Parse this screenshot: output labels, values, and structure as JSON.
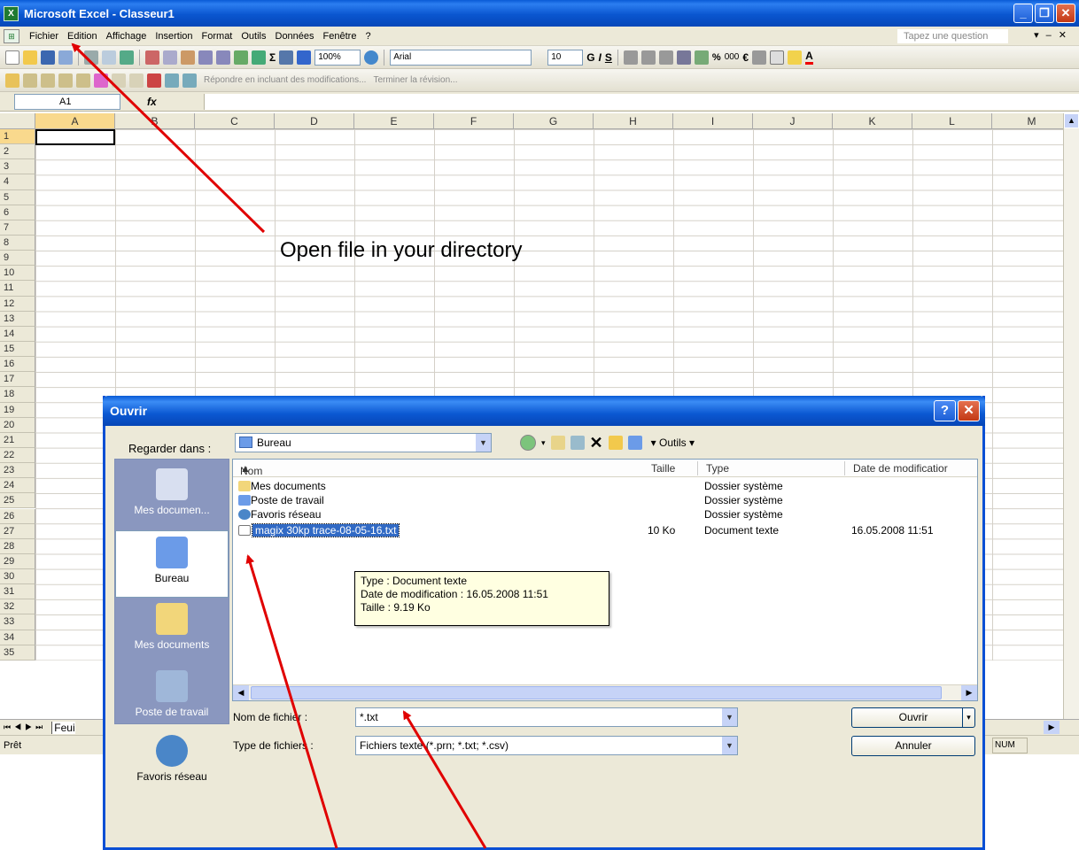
{
  "window": {
    "title": "Microsoft Excel - Classeur1",
    "app_icon": "excel-icon"
  },
  "menu": {
    "items": [
      "Fichier",
      "Edition",
      "Affichage",
      "Insertion",
      "Format",
      "Outils",
      "Données",
      "Fenêtre",
      "?"
    ],
    "help_placeholder": "Tapez une question"
  },
  "toolbar": {
    "zoom": "100%",
    "font": "Arial",
    "font_size": "10",
    "bold": "G",
    "italic": "I",
    "underline": "S",
    "reply_text": "Répondre en incluant des modifications...",
    "end_review": "Terminer la révision..."
  },
  "formula": {
    "cell_ref": "A1",
    "fx": "fx"
  },
  "grid": {
    "columns": [
      "A",
      "B",
      "C",
      "D",
      "E",
      "F",
      "G",
      "H",
      "I",
      "J",
      "K",
      "L",
      "M"
    ],
    "rows": [
      "1",
      "2",
      "3",
      "4",
      "5",
      "6",
      "7",
      "8",
      "9",
      "10",
      "11",
      "12",
      "13",
      "14",
      "15",
      "16",
      "17",
      "18",
      "19",
      "20",
      "21",
      "22",
      "23",
      "24",
      "25",
      "26",
      "27",
      "28",
      "29",
      "30",
      "31",
      "32",
      "33",
      "34",
      "35"
    ],
    "active_cell": "A1"
  },
  "sheets": {
    "tab": "Feui"
  },
  "status": {
    "left": "Prêt",
    "num": "NUM"
  },
  "dialog": {
    "title": "Ouvrir",
    "look_in_label": "Regarder dans :",
    "look_in_value": "Bureau",
    "tools_label": "Outils",
    "places": [
      "Mes documen...",
      "Bureau",
      "Mes documents",
      "Poste de travail",
      "Favoris réseau"
    ],
    "columns": {
      "name": "Nom",
      "size": "Taille",
      "type": "Type",
      "date": "Date de modificatior"
    },
    "files": [
      {
        "name": "Mes documents",
        "size": "",
        "type": "Dossier système",
        "date": "",
        "icon": "my-documents-icon"
      },
      {
        "name": "Poste de travail",
        "size": "",
        "type": "Dossier système",
        "date": "",
        "icon": "computer-icon"
      },
      {
        "name": "Favoris réseau",
        "size": "",
        "type": "Dossier système",
        "date": "",
        "icon": "network-icon"
      },
      {
        "name": "magix 30kp trace-08-05-16.txt",
        "size": "10 Ko",
        "type": "Document texte",
        "date": "16.05.2008 11:51",
        "icon": "text-file-icon",
        "selected": true
      }
    ],
    "tooltip": {
      "line1": "Type : Document texte",
      "line2": "Date de modification : 16.05.2008 11:51",
      "line3": "Taille : 9.19 Ko"
    },
    "filename_label": "Nom de fichier :",
    "filename_value": "*.txt",
    "filetype_label": "Type de fichiers :",
    "filetype_value": "Fichiers texte (*.prn; *.txt; *.csv)",
    "open_button": "Ouvrir",
    "cancel_button": "Annuler"
  },
  "annotation": {
    "text": "Open file in your directory",
    "arrow_color": "#e00000"
  }
}
